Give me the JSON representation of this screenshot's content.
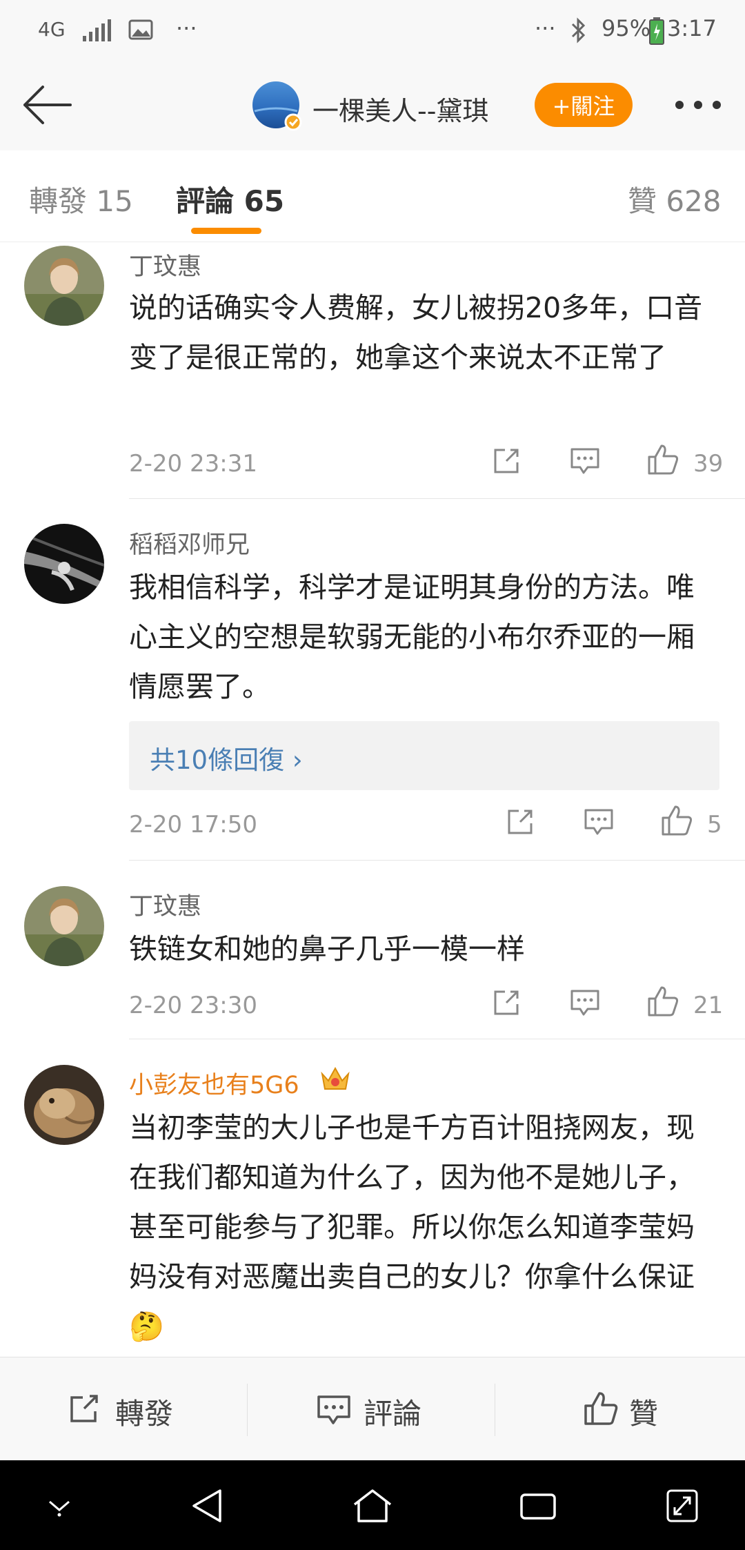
{
  "status_bar": {
    "network": "4G",
    "left_dots": "···",
    "right_dots": "···",
    "battery": "95%",
    "time": "3:17"
  },
  "header": {
    "title": "一棵美人--黛琪",
    "follow_label": "+關注"
  },
  "tabs": [
    {
      "label": "轉發 15",
      "active": false
    },
    {
      "label": "評論 65",
      "active": true
    },
    {
      "label": "贊 628",
      "active": false
    }
  ],
  "comments": [
    {
      "user": "丁玟惠",
      "text": "说的话确实令人费解，女儿被拐20多年，口音变了是很正常的，她拿这个来说太不正常了",
      "time": "2-20 23:31",
      "likes": "39"
    },
    {
      "user": "稻稻邓师兄",
      "text": "我相信科学，科学才是证明其身份的方法。唯心主义的空想是软弱无能的小布尔乔亚的一厢情愿罢了。",
      "replies_label": "共10條回復 ›",
      "time": "2-20 17:50",
      "likes": "5"
    },
    {
      "user": "丁玟惠",
      "text": "铁链女和她的鼻子几乎一模一样",
      "time": "2-20 23:30",
      "likes": "21"
    },
    {
      "user": "小彭友也有5G6",
      "vip": true,
      "text": "当初李莹的大儿子也是千方百计阻挠网友，现在我们都知道为什么了，因为他不是她儿子，甚至可能参与了犯罪。所以你怎么知道李莹妈妈没有对恶魔出卖自己的女儿？你拿什么保证🤔"
    }
  ],
  "action_bar": {
    "repost": "轉發",
    "comment": "評論",
    "like": "贊"
  },
  "colors": {
    "accent": "#fb8c00",
    "link": "#4a7fb4",
    "vip_name": "#e8801c"
  }
}
